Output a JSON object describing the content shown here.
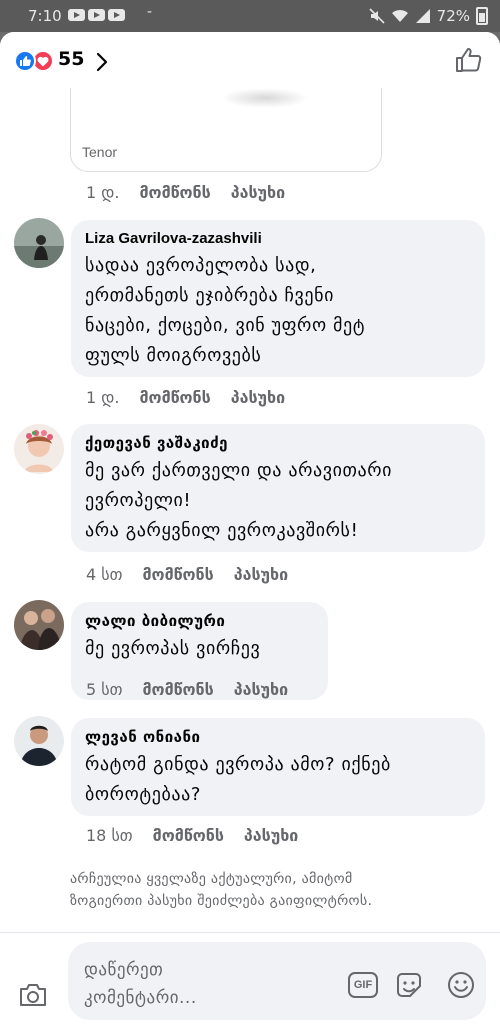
{
  "status_bar": {
    "time": "7:10",
    "separator": "-",
    "battery": "72%"
  },
  "reactions": {
    "count": "55",
    "icons": [
      "like-icon",
      "heart-icon"
    ]
  },
  "gif_card": {
    "source": "Tenor"
  },
  "gif_comment_meta": {
    "time": "1 დ.",
    "like": "მომწონს",
    "reply": "პასუხი"
  },
  "comments": [
    {
      "author": "Liza Gavrilova-zazashvili",
      "lines": [
        "სადაა ევროპელობა სად,",
        "ერთმანეთს ეჯიბრება ჩვენი",
        "ნაცები, ქოცები, ვინ უფრო მეტ",
        "ფულს მოიგროვებს"
      ],
      "time": "1 დ.",
      "like": "მომწონს",
      "reply": "პასუხი"
    },
    {
      "author": "ქეთევან ვაშაკიძე",
      "lines": [
        "მე ვარ ქართველი და არავითარი",
        "ევროპელი!",
        "არა გარყვნილ ევროკავშირს!"
      ],
      "time": "4 სთ",
      "like": "მომწონს",
      "reply": "პასუხი"
    },
    {
      "author": "ლალი ბიბილური",
      "lines": [
        "მე  ევროპას  ვირჩევ"
      ],
      "time": "5 სთ",
      "like": "მომწონს",
      "reply": "პასუხი"
    },
    {
      "author": "ლევან ონიანი",
      "lines": [
        "რატომ გინდა ევროპა ამო? იქნებ",
        "ბოროტებაა?"
      ],
      "time": "18 სთ",
      "like": "მომწონს",
      "reply": "პასუხი"
    }
  ],
  "filter_note": {
    "line1": "არჩეულია ყველაზე აქტუალური, ამიტომ",
    "line2": "ზოგიერთი პასუხი შეიძლება გაიფილტროს."
  },
  "composer": {
    "placeholder_line1": "დაწერეთ",
    "placeholder_line2": "კომენტარი...",
    "gif_label": "GIF"
  }
}
